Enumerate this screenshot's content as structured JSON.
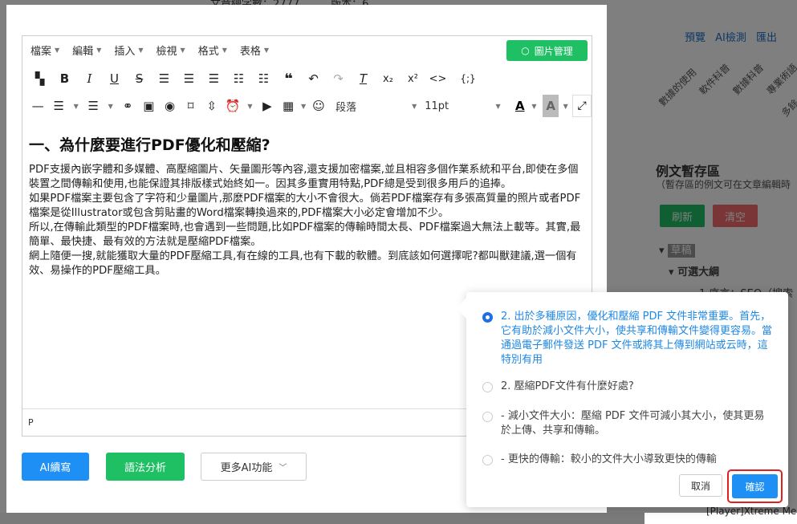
{
  "background": {
    "top_text": "文章總字數：2777　　　版本：6",
    "actions": [
      "預覽",
      "AI檢測",
      "匯出"
    ],
    "tags": [
      "數據的使用",
      "軟件科普",
      "數據科普",
      "專業術語",
      "多餘"
    ],
    "panel_title": "例文暫存區",
    "panel_subtitle": "（暫存區的例文可在文章編輯時",
    "refresh_label": "刷新",
    "clear_label": "清空",
    "tree_draft": "草稿",
    "tree_outline": "可選大綱",
    "tree_item": "1.序言：SEO（搜索",
    "bottom_right_text": "[Player]Xtreme Me"
  },
  "editor": {
    "menus": [
      "檔案",
      "編輯",
      "插入",
      "檢視",
      "格式",
      "表格"
    ],
    "image_manage_label": "圖片管理",
    "block_format": "段落",
    "font_size": "11pt",
    "heading": "一、為什麼要進行PDF優化和壓縮?",
    "paragraphs": [
      "PDF支援內嵌字體和多媒體、高壓縮圖片、矢量圖形等內容,還支援加密檔案,並且相容多個作業系統和平台,即使在多個裝置之間傳輸和使用,也能保證其排版樣式始終如一。因其多重實用特點,PDF總是受到很多用戶的追捧。",
      "如果PDF檔案主要包含了字符和少量圖片,那麼PDF檔案的大小不會很大。倘若PDF檔案存有多張高質量的照片或者PDF檔案是從Illustrator或包含剪貼畫的Word檔案轉換過來的,PDF檔案大小必定會增加不少。",
      "所以,在傳輸此類型的PDF檔案時,也會遇到一些問題,比如PDF檔案的傳輸時間太長、PDF檔案過大無法上載等。其實,最簡單、最快捷、最有效的方法就是壓縮PDF檔案。",
      "網上隨便一搜,就能獲取大量的PDF壓縮工具,有在線的工具,也有下載的軟體。到底該如何選擇呢?都叫獸建議,選一個有效、易操作的PDF壓縮工具。"
    ],
    "status_path": "P"
  },
  "bottom_buttons": {
    "continue_label": "AI續寫",
    "grammar_label": "語法分析",
    "more_label": "更多AI功能"
  },
  "popup": {
    "options": [
      {
        "text": "2. 出於多種原因，優化和壓縮 PDF 文件非常重要。首先，它有助於減小文件大小，使共享和傳輸文件變得更容易。當通過電子郵件發送 PDF 文件或將其上傳到網站或云時，這特別有用",
        "selected": true
      },
      {
        "text": "2. 壓縮PDF文件有什麼好處?",
        "selected": false
      },
      {
        "text": "- 減小文件大小：壓縮 PDF 文件可減小其大小，使其更易於上傳、共享和傳輸。",
        "selected": false
      },
      {
        "text": "- 更快的傳輸：較小的文件大小導致更快的傳輸",
        "selected": false
      }
    ],
    "cancel_label": "取消",
    "confirm_label": "確認"
  }
}
